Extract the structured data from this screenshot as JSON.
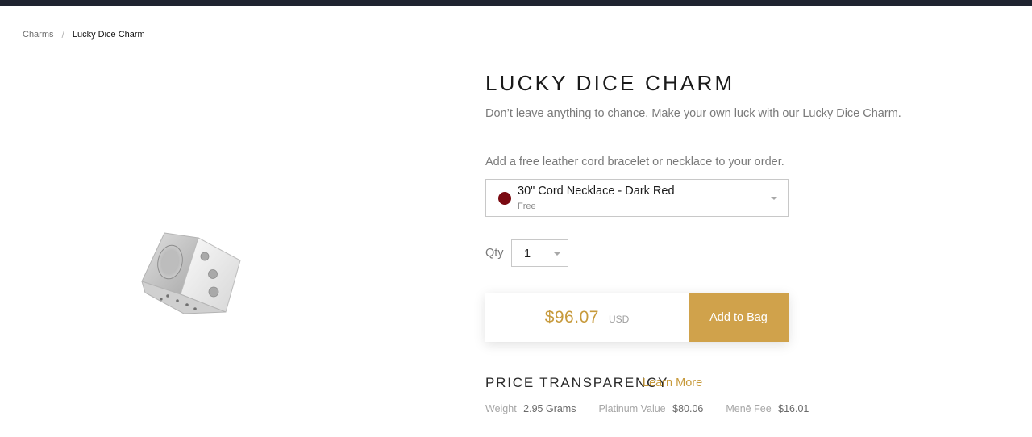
{
  "breadcrumb": {
    "items": [
      "Charms"
    ],
    "separator": "/",
    "current": "Lucky Dice Charm"
  },
  "product": {
    "image_icon": "silver-dice-charm",
    "title": "LUCKY DICE CHARM",
    "description": "Don’t leave anything to chance. Make your own luck with our Lucky Dice Charm."
  },
  "addon": {
    "label": "Add a free leather cord bracelet or necklace to your order.",
    "selected_name": "30\" Cord Necklace - Dark Red",
    "selected_price": "Free",
    "swatch_color": "#7a0a12"
  },
  "quantity": {
    "label": "Qty",
    "value": "1"
  },
  "purchase": {
    "price": "$96.07",
    "currency": "USD",
    "button_label": "Add to Bag",
    "accent_color": "#d0a24b"
  },
  "price_transparency": {
    "heading": "PRICE TRANSPARENCY",
    "link_label": "Learn More",
    "stats": [
      {
        "label": "Weight",
        "value": "2.95 Grams"
      },
      {
        "label": "Platinum Value",
        "value": "$80.06"
      },
      {
        "label": "Menē Fee",
        "value": "$16.01"
      }
    ]
  }
}
